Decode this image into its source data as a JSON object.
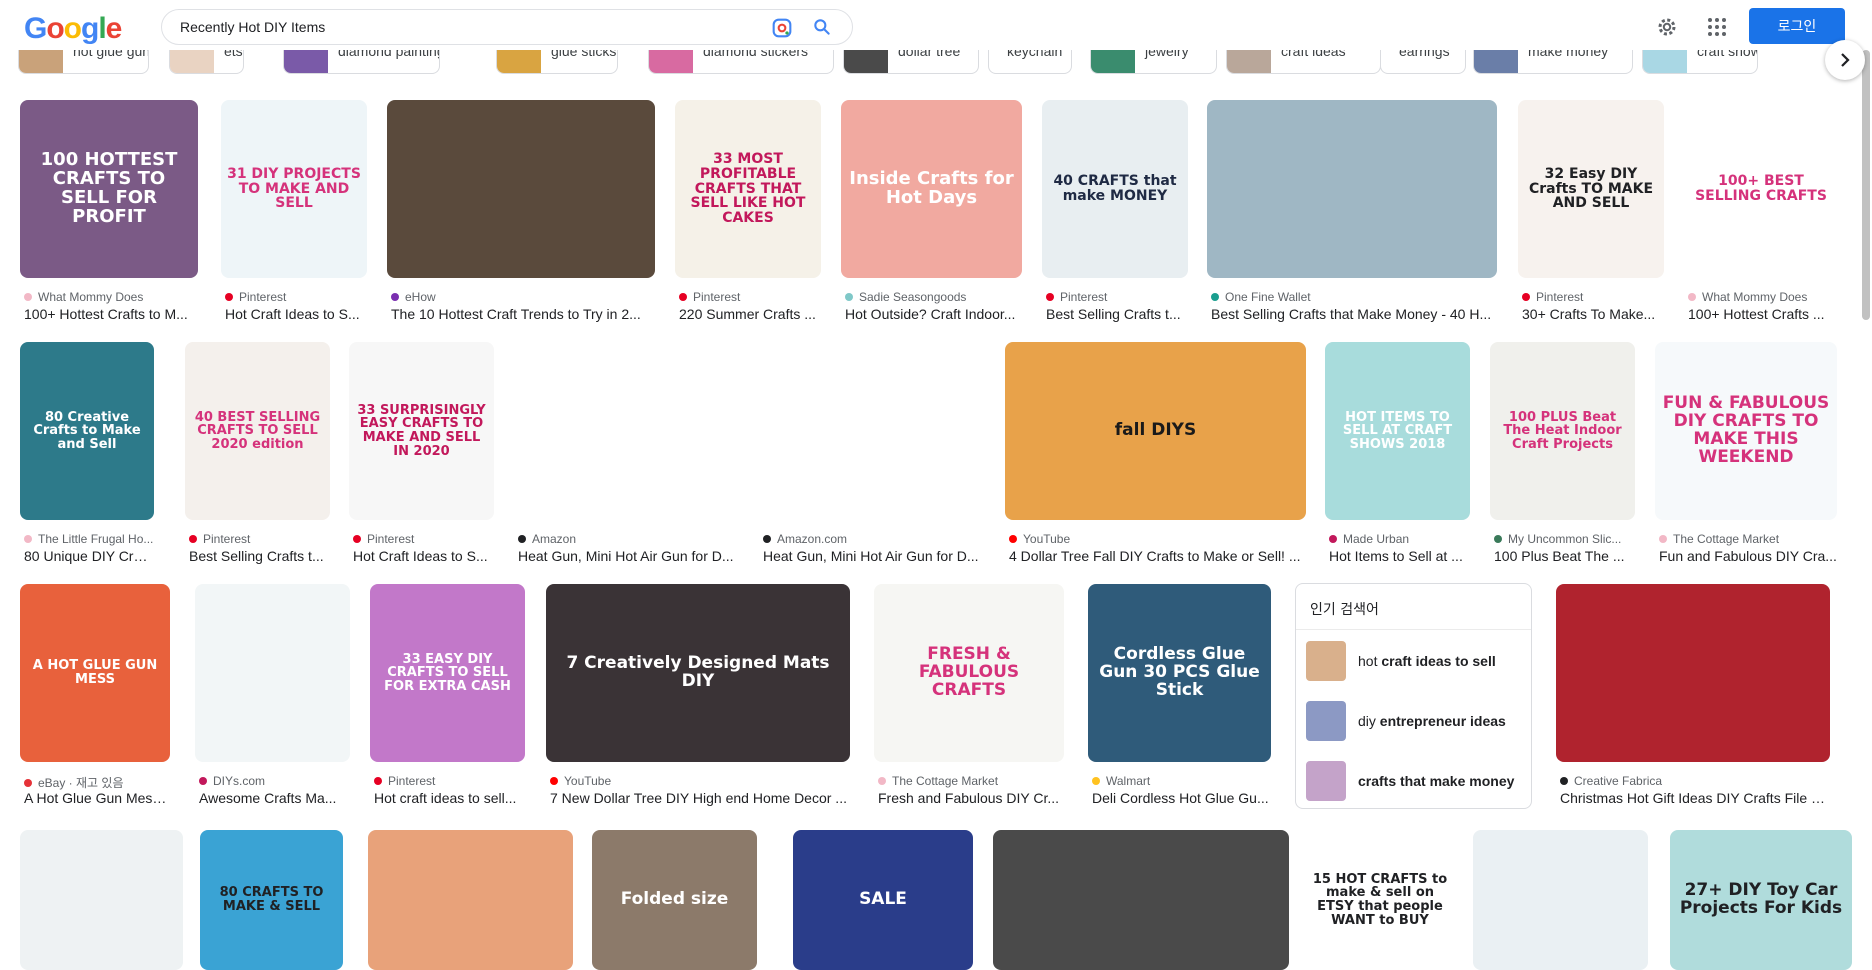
{
  "header": {
    "logo_text": "Google",
    "search_value": "Recently Hot DIY Items",
    "login_label": "로그인"
  },
  "chips": [
    {
      "label": "hot glue gun",
      "color": "#c9a27a"
    },
    {
      "label": "etsy",
      "color": "#e9d3c2"
    },
    {
      "label": "diamond painting",
      "color": "#7a5aa8"
    },
    {
      "label": "glue sticks",
      "color": "#d9a441"
    },
    {
      "label": "diamond stickers",
      "color": "#d86aa1"
    },
    {
      "label": "dollar tree",
      "color": "#4a4a4a"
    },
    {
      "label": "keychain",
      "color": ""
    },
    {
      "label": "jewelry",
      "color": "#3a8c6e"
    },
    {
      "label": "craft ideas",
      "color": "#b9a79a"
    },
    {
      "label": "earrings",
      "color": ""
    },
    {
      "label": "make money",
      "color": "#6a7ea8"
    },
    {
      "label": "craft shows",
      "color": "#a9d7e4"
    }
  ],
  "row1": [
    {
      "source": "What Mommy Does",
      "title": "100+ Hottest Crafts to M...",
      "img_text": "100 HOTTEST CRAFTS TO SELL FOR PROFIT",
      "bg": "#7b5a86",
      "fg": "#ffffff",
      "fav": "#f2b8c6"
    },
    {
      "source": "Pinterest",
      "title": "Hot Craft Ideas to S...",
      "img_text": "31 DIY PROJECTS TO MAKE AND SELL",
      "bg": "#eef5f8",
      "fg": "#d5327b",
      "fav": "#e60023"
    },
    {
      "source": "eHow",
      "title": "The 10 Hottest Craft Trends to Try in 2...",
      "img_text": "",
      "bg": "#5a4a3c",
      "fg": "#ffffff",
      "fav": "#7a2fb0"
    },
    {
      "source": "Pinterest",
      "title": "220 Summer Crafts ...",
      "img_text": "33 MOST PROFITABLE CRAFTS THAT SELL LIKE HOT CAKES",
      "bg": "#f5f1e8",
      "fg": "#c2185b",
      "fav": "#e60023"
    },
    {
      "source": "Sadie Seasongoods",
      "title": "Hot Outside? Craft Indoor...",
      "img_text": "Inside Crafts for Hot Days",
      "bg": "#f1a9a0",
      "fg": "#ffffff",
      "fav": "#7fc8c8"
    },
    {
      "source": "Pinterest",
      "title": "Best Selling Crafts t...",
      "img_text": "40 CRAFTS that make MONEY",
      "bg": "#e8eef1",
      "fg": "#1f2a44",
      "fav": "#e60023"
    },
    {
      "source": "One Fine Wallet",
      "title": "Best Selling Crafts that Make Money - 40 H...",
      "img_text": "",
      "bg": "#9fb7c4",
      "fg": "#ffffff",
      "fav": "#1a9e8f"
    },
    {
      "source": "Pinterest",
      "title": "30+ Crafts To Make...",
      "img_text": "32 Easy DIY Crafts TO MAKE AND SELL",
      "bg": "#f7f2ee",
      "fg": "#202124",
      "fav": "#e60023"
    },
    {
      "source": "What Mommy Does",
      "title": "100+ Hottest Crafts ...",
      "img_text": "100+ BEST SELLING CRAFTS",
      "bg": "#ffffff",
      "fg": "#d5327b",
      "fav": "#f2b8c6"
    }
  ],
  "row2": [
    {
      "source": "The Little Frugal Ho...",
      "title": "80 Unique DIY Craft...",
      "img_text": "80 Creative Crafts to Make and Sell",
      "bg": "#2d7a8a",
      "fg": "#ffffff",
      "fav": "#f2b8c6"
    },
    {
      "source": "Pinterest",
      "title": "Best Selling Crafts t...",
      "img_text": "40 BEST SELLING CRAFTS TO SELL 2020 edition",
      "bg": "#f4f0ec",
      "fg": "#d5327b",
      "fav": "#e60023"
    },
    {
      "source": "Pinterest",
      "title": "Hot Craft Ideas to S...",
      "img_text": "33 SURPRISINGLY EASY CRAFTS TO MAKE AND SELL IN 2020",
      "bg": "#f7f7f7",
      "fg": "#c2185b",
      "fav": "#e60023"
    },
    {
      "source": "Amazon",
      "title": "Heat Gun, Mini Hot Air Gun for D...",
      "img_text": "",
      "bg": "#ffffff",
      "fg": "#e85ea0",
      "fav": "#202124"
    },
    {
      "source": "Amazon.com",
      "title": "Heat Gun, Mini Hot Air Gun for D...",
      "img_text": "",
      "bg": "#ffffff",
      "fg": "#2b5aa8",
      "fav": "#202124"
    },
    {
      "source": "YouTube",
      "title": "4 Dollar Tree Fall DIY Crafts to Make or Sell! ...",
      "img_text": "fall DIYS",
      "bg": "#e8a24a",
      "fg": "#1a1a1a",
      "fav": "#ff0000"
    },
    {
      "source": "Made Urban",
      "title": "Hot Items to Sell at ...",
      "img_text": "HOT ITEMS TO SELL AT CRAFT SHOWS 2018",
      "bg": "#a8dcdc",
      "fg": "#ffffff",
      "fav": "#c2185b"
    },
    {
      "source": "My Uncommon Slic...",
      "title": "100 Plus Beat The ...",
      "img_text": "100 PLUS Beat The Heat Indoor Craft Projects",
      "bg": "#f0f0ec",
      "fg": "#d5327b",
      "fav": "#3a7a5a"
    },
    {
      "source": "The Cottage Market",
      "title": "Fun and Fabulous DIY Cra...",
      "img_text": "FUN & FABULOUS DIY CRAFTS TO MAKE THIS WEEKEND",
      "bg": "#f6f9fb",
      "fg": "#d5327b",
      "fav": "#f2b8c6"
    }
  ],
  "row3": [
    {
      "source": "eBay · 재고 있음",
      "title": "A Hot Glue Gun Mess...",
      "img_text": "A HOT GLUE GUN MESS",
      "bg": "#e8613c",
      "fg": "#ffffff",
      "fav": "#e53238"
    },
    {
      "source": "DIYs.com",
      "title": "Awesome Crafts Ma...",
      "img_text": "",
      "bg": "#f2f6f7",
      "fg": "#2a9d9a",
      "fav": "#c2185b"
    },
    {
      "source": "Pinterest",
      "title": "Hot craft ideas to sell...",
      "img_text": "33 EASY DIY CRAFTS TO SELL FOR EXTRA CASH",
      "bg": "#c278c9",
      "fg": "#ffffff",
      "fav": "#e60023"
    },
    {
      "source": "YouTube",
      "title": "7 New Dollar Tree DIY High end Home Decor ...",
      "img_text": "7 Creatively Designed Mats DIY",
      "bg": "#3a3336",
      "fg": "#ffffff",
      "fav": "#ff0000"
    },
    {
      "source": "The Cottage Market",
      "title": "Fresh and Fabulous DIY Cr...",
      "img_text": "FRESH & FABULOUS CRAFTS",
      "bg": "#f6f6f3",
      "fg": "#d5327b",
      "fav": "#f2b8c6"
    },
    {
      "source": "Walmart",
      "title": "Deli Cordless Hot Glue Gu...",
      "img_text": "Cordless Glue Gun 30 PCS Glue Stick",
      "bg": "#2f5b7a",
      "fg": "#ffffff",
      "fav": "#ffc220"
    },
    {
      "source": "Creative Fabrica",
      "title": "Christmas Hot Gift Ideas DIY Crafts File G...",
      "img_text": "",
      "bg": "#b0232e",
      "fg": "#ffffff",
      "fav": "#202124"
    }
  ],
  "popular": {
    "heading": "인기 검색어",
    "items": [
      {
        "prefix": "hot ",
        "bold": "craft ideas to sell",
        "color": "#d9b08c"
      },
      {
        "prefix": "diy ",
        "bold": "entrepreneur ideas",
        "color": "#8c99c4"
      },
      {
        "prefix": "",
        "bold": "crafts that make money",
        "color": "#c4a3c9"
      }
    ]
  },
  "row4": [
    {
      "img_text": "",
      "bg": "#eef2f3",
      "fg": "#202124"
    },
    {
      "img_text": "80 CRAFTS TO MAKE & SELL",
      "bg": "#3aa3d4",
      "fg": "#202124"
    },
    {
      "img_text": "",
      "bg": "#e8a27a",
      "fg": "#ffffff"
    },
    {
      "img_text": "Folded size",
      "bg": "#8c7a6a",
      "fg": "#ffffff"
    },
    {
      "img_text": "SALE",
      "bg": "#2a3d8a",
      "fg": "#ffffff"
    },
    {
      "img_text": "",
      "bg": "#4a4a4a",
      "fg": "#ffffff"
    },
    {
      "img_text": "15 HOT CRAFTS to make & sell on ETSY that people WANT to BUY",
      "bg": "#ffffff",
      "fg": "#202124"
    },
    {
      "img_text": "",
      "bg": "#eaf0f3",
      "fg": "#2a9d9a"
    },
    {
      "img_text": "27+ DIY Toy Car Projects For Kids",
      "bg": "#b0dcdc",
      "fg": "#202124"
    }
  ]
}
